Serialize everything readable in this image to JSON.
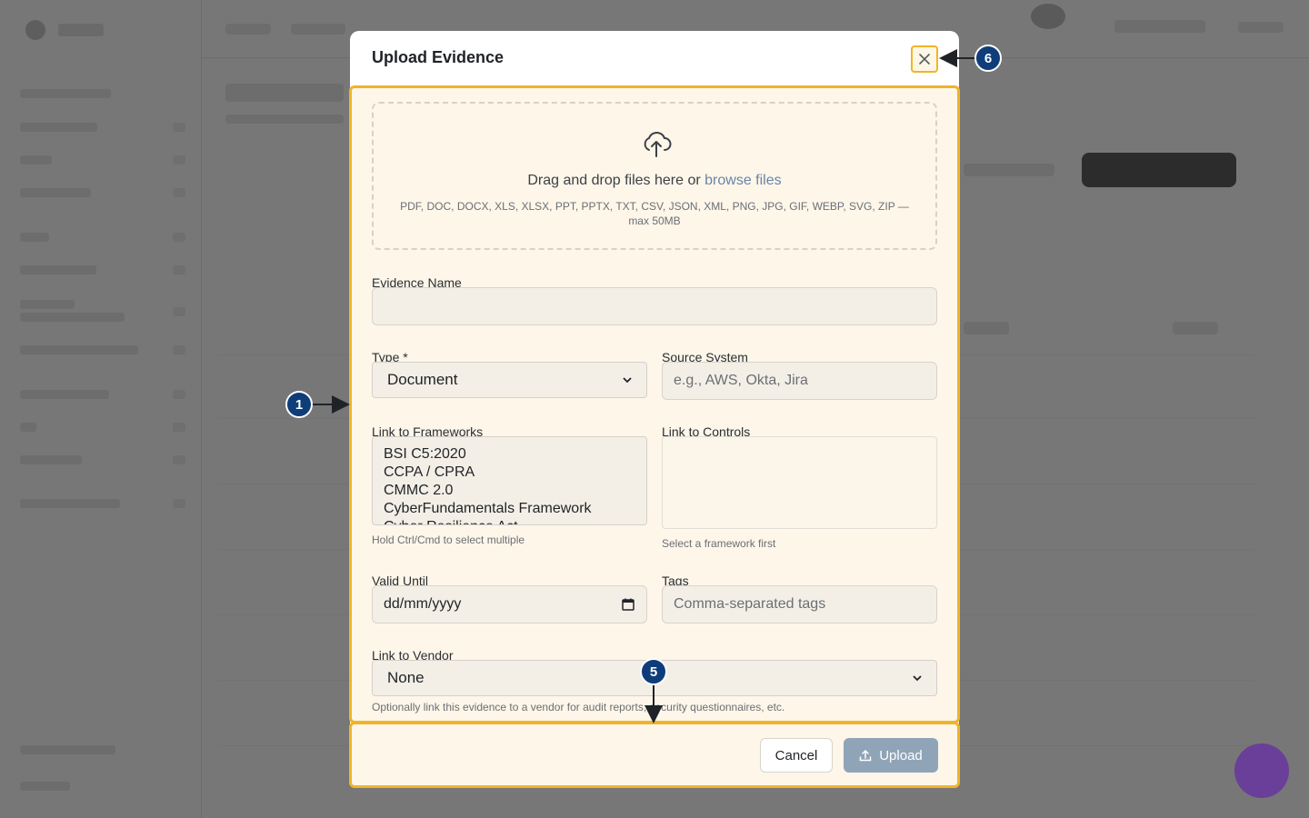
{
  "modal": {
    "title": "Upload Evidence",
    "dropzone": {
      "text_prefix": "Drag and drop files here or ",
      "link_text": "browse files",
      "hint": "PDF, DOC, DOCX, XLS, XLSX, PPT, PPTX, TXT, CSV, JSON, XML, PNG, JPG, GIF, WEBP, SVG, ZIP — max 50MB"
    },
    "fields": {
      "evidence_name": {
        "label": "Evidence Name",
        "value": ""
      },
      "type": {
        "label": "Type *",
        "value": "Document"
      },
      "source_system": {
        "label": "Source System",
        "placeholder": "e.g., AWS, Okta, Jira"
      },
      "frameworks": {
        "label": "Link to Frameworks",
        "options": [
          "BSI C5:2020",
          "CCPA / CPRA",
          "CMMC 2.0",
          "CyberFundamentals Framework",
          "Cyber Resilience Act"
        ],
        "helper": "Hold Ctrl/Cmd to select multiple"
      },
      "controls": {
        "label": "Link to Controls",
        "helper": "Select a framework first"
      },
      "valid_until": {
        "label": "Valid Until",
        "placeholder": "dd/mm/yyyy"
      },
      "tags": {
        "label": "Tags",
        "placeholder": "Comma-separated tags"
      },
      "vendor": {
        "label": "Link to Vendor",
        "value": "None",
        "helper": "Optionally link this evidence to a vendor for audit reports, security questionnaires, etc."
      }
    },
    "footer": {
      "cancel_label": "Cancel",
      "upload_label": "Upload"
    }
  },
  "annotations": {
    "badge_1": "1",
    "badge_5": "5",
    "badge_6": "6"
  },
  "colors": {
    "highlight": "#f0b429",
    "badge": "#0f3d7a",
    "upload_button": "#90a4b8",
    "link": "#6b84a8"
  },
  "icons": {
    "close": "close-icon",
    "upload_cloud": "upload-cloud-icon",
    "calendar": "calendar-icon",
    "upload": "upload-icon"
  }
}
